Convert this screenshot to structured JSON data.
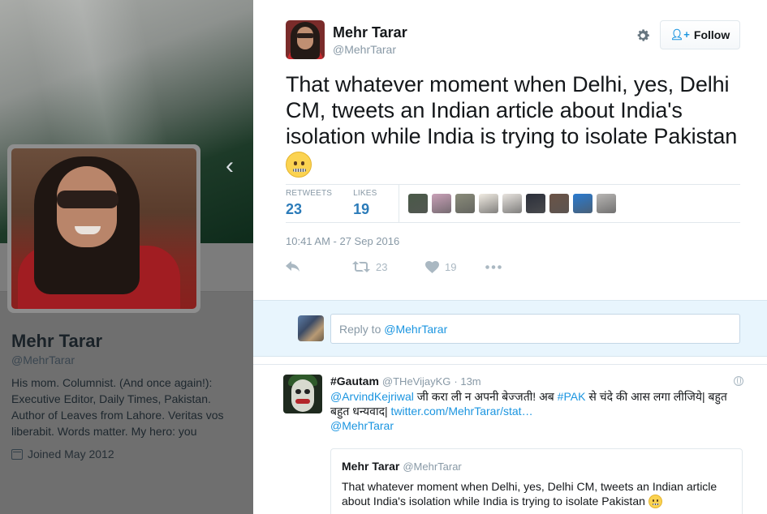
{
  "profile": {
    "name": "Mehr Tarar",
    "handle": "@MehrTarar",
    "bio": "His mom. Columnist. (And once again!): Executive Editor, Daily Times, Pakistan. Author of Leaves from Lahore. Veritas vos liberabit. Words matter. My hero: you",
    "joined": "Joined May 2012"
  },
  "tweet": {
    "author_name": "Mehr Tarar",
    "author_handle": "@MehrTarar",
    "follow_label": "Follow",
    "text": "That whatever moment when Delhi, yes, Delhi CM, tweets an Indian article about India's isolation while India is trying to isolate Pakistan",
    "emoji": "zipper-mouth-face",
    "retweets_label": "RETWEETS",
    "retweets": "23",
    "likes_label": "LIKES",
    "likes": "19",
    "liker_colors": [
      "#4a5a48",
      "#c9a1b8",
      "#8a8c7a",
      "#f1ece3",
      "#e8e4df",
      "#2b2f3a",
      "#6b5346",
      "#2a7bd0",
      "#b8b6b4"
    ],
    "timestamp": "10:41 AM - 27 Sep 2016",
    "action_retweets": "23",
    "action_likes": "19"
  },
  "reply_box": {
    "prefix": "Reply to ",
    "mention": "@MehrTarar"
  },
  "reply": {
    "author_name": "#Gautam",
    "author_handle": "@THeVijayKG",
    "time": "· 13m",
    "mention": "@ArvindKejriwal",
    "text_part1": " जी करा ली न अपनी बेज्जती! अब ",
    "hashtag": "#PAK",
    "text_part2": " से चंदे की आस लगा लीजिये| बहुत बहुत धन्यवाद| ",
    "link": "twitter.com/MehrTarar/stat…",
    "mention2": "@MehrTarar",
    "quote": {
      "author_name": "Mehr Tarar",
      "author_handle": "@MehrTarar",
      "text": "That whatever moment when Delhi, yes, Delhi CM, tweets an Indian article about India's isolation while India is trying to isolate Pakistan"
    }
  }
}
